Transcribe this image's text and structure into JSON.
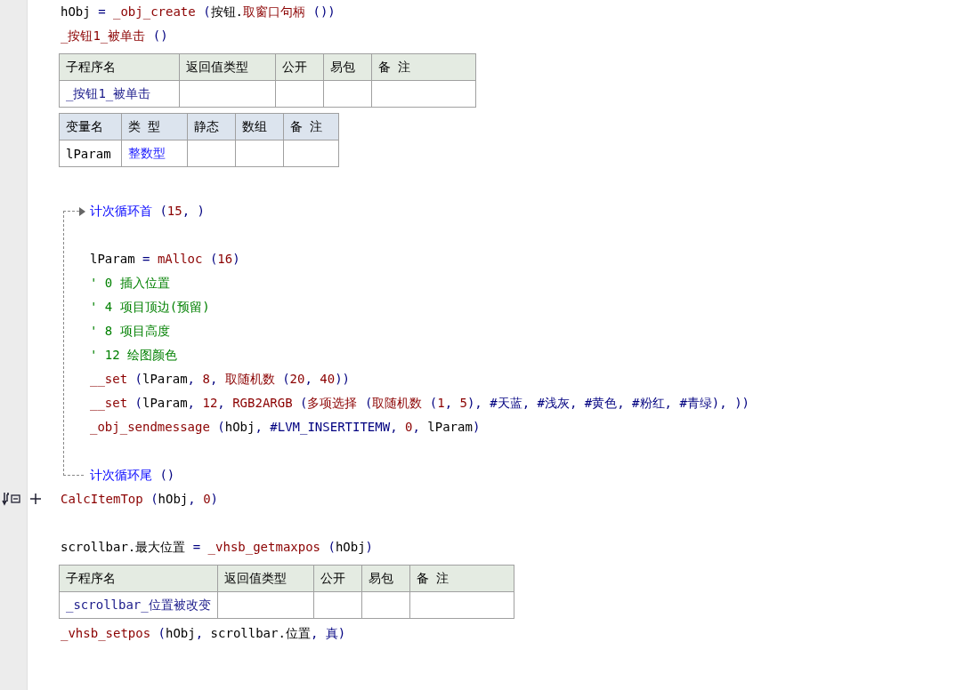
{
  "lines": [
    {
      "kind": "code",
      "tokens": [
        {
          "text": "hObj",
          "kind": "text"
        },
        {
          "text": " = ",
          "kind": "punct"
        },
        {
          "text": "_obj_create",
          "kind": "func"
        },
        {
          "text": " (",
          "kind": "punct"
        },
        {
          "text": "按钮.",
          "kind": "text"
        },
        {
          "text": "取窗口句柄",
          "kind": "func"
        },
        {
          "text": " ())",
          "kind": "punct"
        }
      ]
    },
    {
      "kind": "code",
      "tokens": [
        {
          "text": "_按钮1_被单击",
          "kind": "func"
        },
        {
          "text": " ()",
          "kind": "punct"
        }
      ]
    },
    {
      "kind": "subtable",
      "columns": [
        "子程序名",
        "返回值类型",
        "公开",
        "易包",
        "备 注"
      ],
      "rows": [
        [
          "_按钮1_被单击"
        ]
      ]
    },
    {
      "kind": "vartable",
      "columns": [
        "变量名",
        "类 型",
        "静态",
        "数组",
        "备 注"
      ],
      "rows": [
        [
          "lParam",
          "整数型"
        ]
      ]
    },
    {
      "kind": "blank"
    },
    {
      "kind": "loop",
      "head": [
        {
          "text": "计次循环首",
          "kind": "loop"
        },
        {
          "text": " (",
          "kind": "punct"
        },
        {
          "text": "15",
          "kind": "num"
        },
        {
          "text": ", )",
          "kind": "punct"
        }
      ],
      "children": [
        {
          "kind": "blank"
        },
        {
          "kind": "code",
          "tokens": [
            {
              "text": "lParam",
              "kind": "text"
            },
            {
              "text": " = ",
              "kind": "punct"
            },
            {
              "text": "mAlloc",
              "kind": "func"
            },
            {
              "text": " (",
              "kind": "punct"
            },
            {
              "text": "16",
              "kind": "num"
            },
            {
              "text": ")",
              "kind": "punct"
            }
          ]
        },
        {
          "kind": "code",
          "tokens": [
            {
              "text": "' 0 插入位置",
              "kind": "comment"
            }
          ]
        },
        {
          "kind": "code",
          "tokens": [
            {
              "text": "' 4 项目顶边(预留)",
              "kind": "comment"
            }
          ]
        },
        {
          "kind": "code",
          "tokens": [
            {
              "text": "' 8 项目高度",
              "kind": "comment"
            }
          ]
        },
        {
          "kind": "code",
          "tokens": [
            {
              "text": "' 12 绘图颜色",
              "kind": "comment"
            }
          ]
        },
        {
          "kind": "code",
          "tokens": [
            {
              "text": "__set",
              "kind": "func"
            },
            {
              "text": " (",
              "kind": "punct"
            },
            {
              "text": "lParam",
              "kind": "text"
            },
            {
              "text": ", ",
              "kind": "punct"
            },
            {
              "text": "8",
              "kind": "num"
            },
            {
              "text": ", ",
              "kind": "punct"
            },
            {
              "text": "取随机数",
              "kind": "func"
            },
            {
              "text": " (",
              "kind": "punct"
            },
            {
              "text": "20",
              "kind": "num"
            },
            {
              "text": ", ",
              "kind": "punct"
            },
            {
              "text": "40",
              "kind": "num"
            },
            {
              "text": "))",
              "kind": "punct"
            }
          ]
        },
        {
          "kind": "code",
          "tokens": [
            {
              "text": "__set",
              "kind": "func"
            },
            {
              "text": " (",
              "kind": "punct"
            },
            {
              "text": "lParam",
              "kind": "text"
            },
            {
              "text": ", ",
              "kind": "punct"
            },
            {
              "text": "12",
              "kind": "num"
            },
            {
              "text": ", ",
              "kind": "punct"
            },
            {
              "text": "RGB2ARGB",
              "kind": "func"
            },
            {
              "text": " (",
              "kind": "punct"
            },
            {
              "text": "多项选择",
              "kind": "func"
            },
            {
              "text": " (",
              "kind": "punct"
            },
            {
              "text": "取随机数",
              "kind": "func"
            },
            {
              "text": " (",
              "kind": "punct"
            },
            {
              "text": "1",
              "kind": "num"
            },
            {
              "text": ", ",
              "kind": "punct"
            },
            {
              "text": "5",
              "kind": "num"
            },
            {
              "text": "), ",
              "kind": "punct"
            },
            {
              "text": "#天蓝",
              "kind": "const"
            },
            {
              "text": ", ",
              "kind": "punct"
            },
            {
              "text": "#浅灰",
              "kind": "const"
            },
            {
              "text": ", ",
              "kind": "punct"
            },
            {
              "text": "#黄色",
              "kind": "const"
            },
            {
              "text": ", ",
              "kind": "punct"
            },
            {
              "text": "#粉红",
              "kind": "const"
            },
            {
              "text": ", ",
              "kind": "punct"
            },
            {
              "text": "#青绿",
              "kind": "const"
            },
            {
              "text": "), ))",
              "kind": "punct"
            }
          ]
        },
        {
          "kind": "code",
          "tokens": [
            {
              "text": "_obj_sendmessage",
              "kind": "func"
            },
            {
              "text": " (",
              "kind": "punct"
            },
            {
              "text": "hObj",
              "kind": "text"
            },
            {
              "text": ", ",
              "kind": "punct"
            },
            {
              "text": "#LVM_INSERTITEMW",
              "kind": "const"
            },
            {
              "text": ", ",
              "kind": "punct"
            },
            {
              "text": "0",
              "kind": "num"
            },
            {
              "text": ", ",
              "kind": "punct"
            },
            {
              "text": "lParam",
              "kind": "text"
            },
            {
              "text": ")",
              "kind": "punct"
            }
          ]
        },
        {
          "kind": "blank"
        }
      ],
      "tail": [
        {
          "text": "计次循环尾",
          "kind": "loop"
        },
        {
          "text": " ()",
          "kind": "punct"
        }
      ]
    },
    {
      "kind": "code",
      "bookmark": true,
      "tokens": [
        {
          "text": "CalcItemTop",
          "kind": "func"
        },
        {
          "text": " (",
          "kind": "punct"
        },
        {
          "text": "hObj",
          "kind": "text"
        },
        {
          "text": ", ",
          "kind": "punct"
        },
        {
          "text": "0",
          "kind": "num"
        },
        {
          "text": ")",
          "kind": "punct"
        }
      ]
    },
    {
      "kind": "blank"
    },
    {
      "kind": "code",
      "tokens": [
        {
          "text": "scrollbar.最大位置",
          "kind": "text"
        },
        {
          "text": " = ",
          "kind": "punct"
        },
        {
          "text": "_vhsb_getmaxpos",
          "kind": "func"
        },
        {
          "text": " (",
          "kind": "punct"
        },
        {
          "text": "hObj",
          "kind": "text"
        },
        {
          "text": ")",
          "kind": "punct"
        }
      ]
    },
    {
      "kind": "subtable",
      "columns": [
        "子程序名",
        "返回值类型",
        "公开",
        "易包",
        "备 注"
      ],
      "rows": [
        [
          "_scrollbar_位置被改变"
        ]
      ]
    },
    {
      "kind": "code",
      "tokens": [
        {
          "text": "_vhsb_setpos",
          "kind": "func"
        },
        {
          "text": " (",
          "kind": "punct"
        },
        {
          "text": "hObj",
          "kind": "text"
        },
        {
          "text": ", ",
          "kind": "punct"
        },
        {
          "text": "scrollbar.位置",
          "kind": "text"
        },
        {
          "text": ", ",
          "kind": "punct"
        },
        {
          "text": "真",
          "kind": "const"
        },
        {
          "text": ")",
          "kind": "punct"
        }
      ]
    }
  ]
}
